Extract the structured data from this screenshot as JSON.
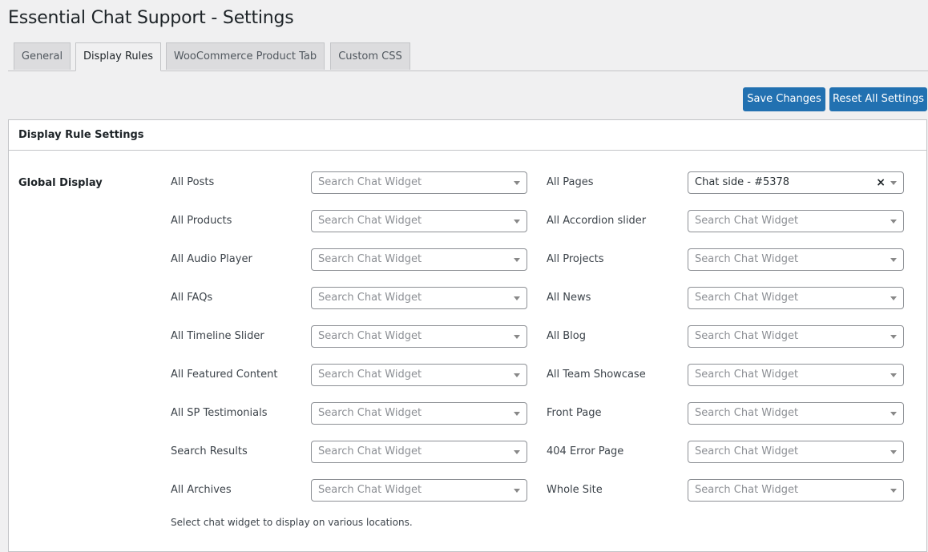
{
  "page": {
    "title": "Essential Chat Support - Settings"
  },
  "tabs": [
    {
      "label": "General",
      "active": false
    },
    {
      "label": "Display Rules",
      "active": true
    },
    {
      "label": "WooCommerce Product Tab",
      "active": false
    },
    {
      "label": "Custom CSS",
      "active": false
    }
  ],
  "actions": {
    "save_label": "Save Changes",
    "reset_label": "Reset All Settings"
  },
  "colors": {
    "accent": "#2271b1",
    "background": "#f0f0f1",
    "border": "#c3c4c7"
  },
  "panel": {
    "title": "Display Rule Settings",
    "section_label": "Global Display",
    "help_text": "Select chat widget to display on various locations.",
    "placeholder": "Search Chat Widget",
    "left_fields": [
      {
        "label": "All Posts",
        "value": ""
      },
      {
        "label": "All Products",
        "value": ""
      },
      {
        "label": "All Audio Player",
        "value": ""
      },
      {
        "label": "All FAQs",
        "value": ""
      },
      {
        "label": "All Timeline Slider",
        "value": ""
      },
      {
        "label": "All Featured Content",
        "value": ""
      },
      {
        "label": "All SP Testimonials",
        "value": ""
      },
      {
        "label": "Search Results",
        "value": ""
      },
      {
        "label": "All Archives",
        "value": ""
      }
    ],
    "right_fields": [
      {
        "label": "All Pages",
        "value": "Chat side - #5378"
      },
      {
        "label": "All Accordion slider",
        "value": ""
      },
      {
        "label": "All Projects",
        "value": ""
      },
      {
        "label": "All News",
        "value": ""
      },
      {
        "label": "All Blog",
        "value": ""
      },
      {
        "label": "All Team Showcase",
        "value": ""
      },
      {
        "label": "Front Page",
        "value": ""
      },
      {
        "label": "404 Error Page",
        "value": ""
      },
      {
        "label": "Whole Site",
        "value": ""
      }
    ],
    "clear_glyph": "×"
  }
}
